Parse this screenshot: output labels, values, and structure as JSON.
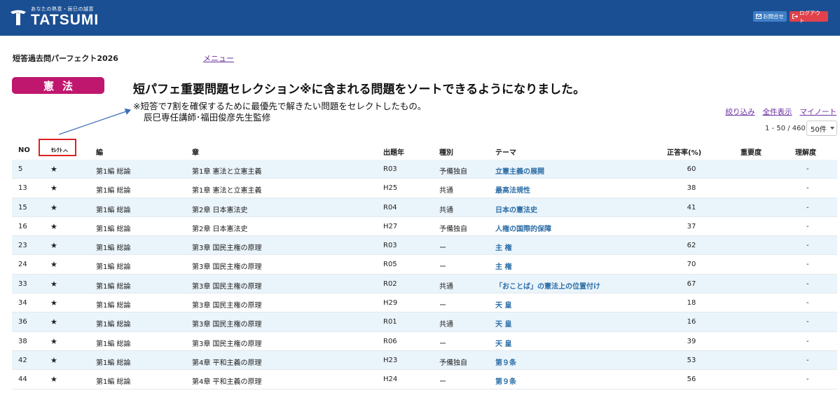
{
  "header": {
    "logo_tagline": "あなたの熱意・辰巳の誠意",
    "logo_name": "TATSUMI",
    "contact_label": "お問合せ",
    "logout_label": "ログアウト",
    "colors": {
      "bar": "#1b4f93",
      "contact": "#3f7fc7",
      "logout": "#e0414b"
    }
  },
  "page": {
    "course_title": "短答過去問パーフェクト2026",
    "menu_link": "メニュー",
    "subject": "憲法",
    "subject_color": "#c0176e",
    "announcement": "短パフェ重要問題セレクション※に含まれる問題をソートできるようになりました。",
    "note_line1": "※短答で7割を確保するために最優先で解きたい問題をセレクトしたもの。",
    "note_line2": "辰巳専任講師･福田俊彦先生監修"
  },
  "controls": {
    "filter": "絞り込み",
    "show_all": "全件表示",
    "my_note": "マイノート",
    "count_text": "1 - 50 / 460",
    "per_page": "50件"
  },
  "table": {
    "headers": {
      "no": "NO",
      "select": "ｾﾚｸﾄ",
      "hen": "編",
      "sho": "章",
      "year": "出題年",
      "type": "種別",
      "theme": "テーマ",
      "rate": "正答率(%)",
      "importance": "重要度",
      "understanding": "理解度"
    },
    "rows": [
      {
        "no": "5",
        "star": "★",
        "hen": "第1編 総論",
        "sho": "第1章 憲法と立憲主義",
        "year": "R03",
        "type": "予備独自",
        "theme": "立憲主義の展開",
        "rate": "60",
        "imp": "",
        "und": "-"
      },
      {
        "no": "13",
        "star": "★",
        "hen": "第1編 総論",
        "sho": "第1章 憲法と立憲主義",
        "year": "H25",
        "type": "共通",
        "theme": "最高法規性",
        "rate": "38",
        "imp": "",
        "und": "-"
      },
      {
        "no": "15",
        "star": "★",
        "hen": "第1編 総論",
        "sho": "第2章 日本憲法史",
        "year": "R04",
        "type": "共通",
        "theme": "日本の憲法史",
        "rate": "41",
        "imp": "",
        "und": "-"
      },
      {
        "no": "16",
        "star": "★",
        "hen": "第1編 総論",
        "sho": "第2章 日本憲法史",
        "year": "H27",
        "type": "予備独自",
        "theme": "人権の国際的保障",
        "rate": "37",
        "imp": "",
        "und": "-"
      },
      {
        "no": "23",
        "star": "★",
        "hen": "第1編 総論",
        "sho": "第3章 国民主権の原理",
        "year": "R03",
        "type": "ー",
        "theme": "主 権",
        "rate": "62",
        "imp": "",
        "und": "-"
      },
      {
        "no": "24",
        "star": "★",
        "hen": "第1編 総論",
        "sho": "第3章 国民主権の原理",
        "year": "R05",
        "type": "ー",
        "theme": "主 権",
        "rate": "70",
        "imp": "",
        "und": "-"
      },
      {
        "no": "33",
        "star": "★",
        "hen": "第1編 総論",
        "sho": "第3章 国民主権の原理",
        "year": "R02",
        "type": "共通",
        "theme": "「おことば」の憲法上の位置付け",
        "rate": "67",
        "imp": "",
        "und": "-"
      },
      {
        "no": "34",
        "star": "★",
        "hen": "第1編 総論",
        "sho": "第3章 国民主権の原理",
        "year": "H29",
        "type": "ー",
        "theme": "天 皇",
        "rate": "18",
        "imp": "",
        "und": "-"
      },
      {
        "no": "36",
        "star": "★",
        "hen": "第1編 総論",
        "sho": "第3章 国民主権の原理",
        "year": "R01",
        "type": "共通",
        "theme": "天 皇",
        "rate": "16",
        "imp": "",
        "und": "-"
      },
      {
        "no": "38",
        "star": "★",
        "hen": "第1編 総論",
        "sho": "第3章 国民主権の原理",
        "year": "R06",
        "type": "ー",
        "theme": "天 皇",
        "rate": "39",
        "imp": "",
        "und": "-"
      },
      {
        "no": "42",
        "star": "★",
        "hen": "第1編 総論",
        "sho": "第4章 平和主義の原理",
        "year": "H23",
        "type": "予備独自",
        "theme": "第９条",
        "rate": "53",
        "imp": "",
        "und": "-"
      },
      {
        "no": "44",
        "star": "★",
        "hen": "第1編 総論",
        "sho": "第4章 平和主義の原理",
        "year": "H24",
        "type": "ー",
        "theme": "第９条",
        "rate": "56",
        "imp": "",
        "und": "-"
      }
    ]
  }
}
